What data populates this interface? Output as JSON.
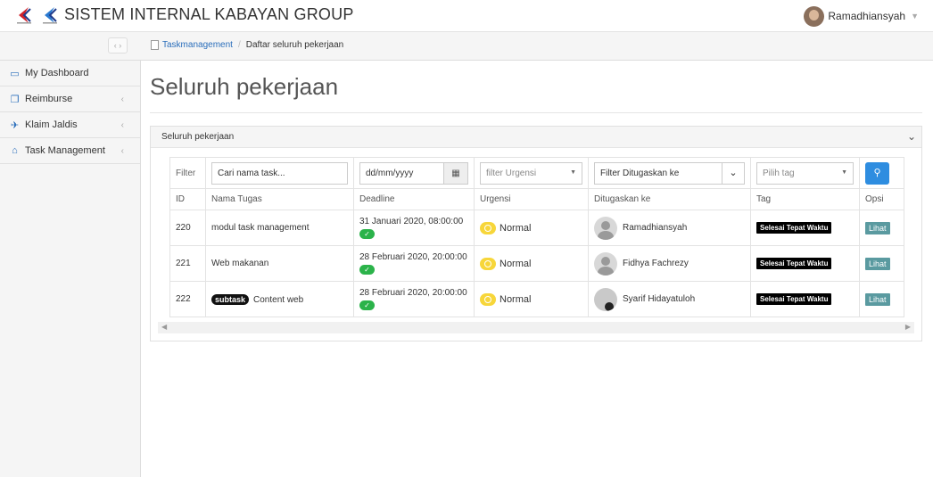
{
  "app": {
    "title": "SISTEM INTERNAL KABAYAN GROUP"
  },
  "user": {
    "name": "Ramadhiansyah"
  },
  "breadcrumb": {
    "parent": "Taskmanagement",
    "current": "Daftar seluruh pekerjaan"
  },
  "sidebar": {
    "items": [
      {
        "label": "My Dashboard",
        "icon": "monitor-icon"
      },
      {
        "label": "Reimburse",
        "icon": "copy-icon"
      },
      {
        "label": "Klaim Jaldis",
        "icon": "plane-icon"
      },
      {
        "label": "Task Management",
        "icon": "home-icon"
      }
    ]
  },
  "page": {
    "title": "Seluruh pekerjaan"
  },
  "panel": {
    "title": "Seluruh pekerjaan"
  },
  "filters": {
    "label": "Filter",
    "task_placeholder": "Cari nama task...",
    "date_placeholder": "dd/mm/yyyy",
    "urgensi_placeholder": "filter Urgensi",
    "ditugaskan_placeholder": "Filter Ditugaskan ke",
    "tag_placeholder": "Pilih tag"
  },
  "table": {
    "headers": [
      "ID",
      "Nama Tugas",
      "Deadline",
      "Urgensi",
      "Ditugaskan ke",
      "Tag",
      "Opsi"
    ],
    "rows": [
      {
        "id": "220",
        "subtask": "",
        "nama": "modul task management",
        "deadline": "31 Januari 2020, 08:00:00",
        "urgensi": "Normal",
        "ditugaskan": "Ramadhiansyah",
        "tag": "Selesai Tepat Waktu",
        "opsi": "Lihat"
      },
      {
        "id": "221",
        "subtask": "",
        "nama": "Web makanan",
        "deadline": "28 Februari 2020, 20:00:00",
        "urgensi": "Normal",
        "ditugaskan": "Fidhya Fachrezy",
        "tag": "Selesai Tepat Waktu",
        "opsi": "Lihat"
      },
      {
        "id": "222",
        "subtask": "subtask",
        "nama": "Content web",
        "deadline": "28 Februari 2020, 20:00:00",
        "urgensi": "Normal",
        "ditugaskan": "Syarif Hidayatuloh",
        "tag": "Selesai Tepat Waktu",
        "opsi": "Lihat"
      }
    ]
  },
  "colors": {
    "accent": "#2e8de0",
    "success": "#2bb34a",
    "warning": "#f7d63a",
    "lihat": "#5a9aa0"
  }
}
